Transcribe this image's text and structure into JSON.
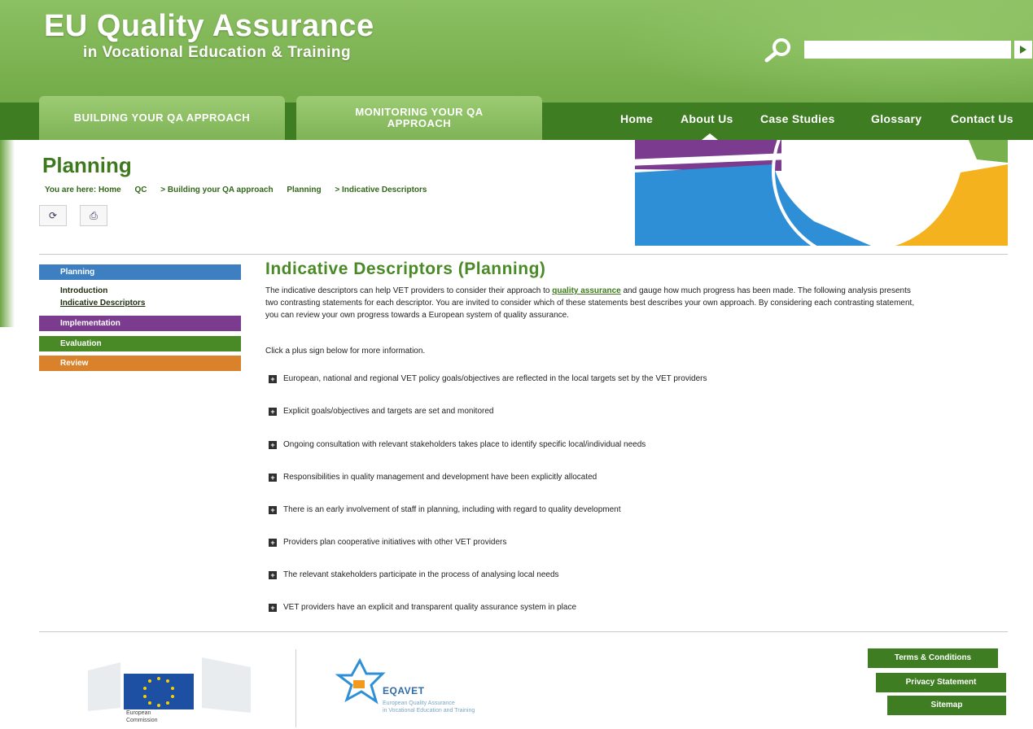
{
  "site": {
    "title": "EU Quality Assurance",
    "subtitle": "in Vocational Education & Training"
  },
  "search": {
    "placeholder": ""
  },
  "qa_tabs": [
    "BUILDING YOUR QA APPROACH",
    "MONITORING YOUR QA APPROACH"
  ],
  "main_nav": [
    "Home",
    "About Us",
    "Case Studies",
    "Glossary",
    "Contact Us"
  ],
  "page": {
    "title": "Planning",
    "breadcrumb": [
      "You are here: Home",
      "QC",
      "> Building your QA approach",
      "Planning",
      "> Indicative Descriptors"
    ]
  },
  "toolbar": {
    "back_label": "⟳",
    "print_label": "⎙"
  },
  "left_nav": {
    "items": [
      {
        "label": "Planning",
        "color": "#3d7fc1"
      },
      {
        "label": "Implementation",
        "color": "#7b3c8f"
      },
      {
        "label": "Evaluation",
        "color": "#4a8a26"
      },
      {
        "label": "Review",
        "color": "#d9822b"
      }
    ],
    "sub_items": [
      "Introduction",
      "Indicative Descriptors"
    ]
  },
  "content": {
    "title": "Indicative Descriptors (Planning)",
    "intro_part1": "The indicative descriptors can help VET providers to consider their approach to ",
    "intro_link": "quality assurance",
    "intro_part2": " and gauge how much progress has been made. The following analysis presents two contrasting statements for each descriptor. You are invited to consider which of these statements best describes your own approach. By considering each contrasting statement, you can review your own progress towards a European system of quality assurance.",
    "click_help": "Click a plus sign below for more information.",
    "descriptors": [
      "European, national and regional VET policy goals/objectives are reflected in the local targets set by the VET providers",
      "Explicit goals/objectives and targets are set and monitored",
      "Ongoing consultation with relevant stakeholders takes place to identify specific local/individual needs",
      "Responsibilities in quality management and development have been explicitly allocated",
      "There is an early involvement of staff in planning, including with regard to quality development",
      "Providers plan cooperative initiatives with other VET providers",
      "The relevant stakeholders participate in the process of analysing local needs",
      "VET providers have an explicit and transparent quality assurance system in place"
    ]
  },
  "footer": {
    "links": [
      "Terms & Conditions",
      "Privacy Statement",
      "Sitemap"
    ],
    "ec_caption": [
      "European",
      "Commission"
    ],
    "eqavet_name": "EQAVET",
    "eqavet_sub": [
      "European Quality Assurance",
      "in Vocational Education and Training"
    ]
  },
  "colors": {
    "header_green": "#79b04e",
    "nav_dark_green": "#3f7d22",
    "title_green": "#3e7a1d"
  }
}
